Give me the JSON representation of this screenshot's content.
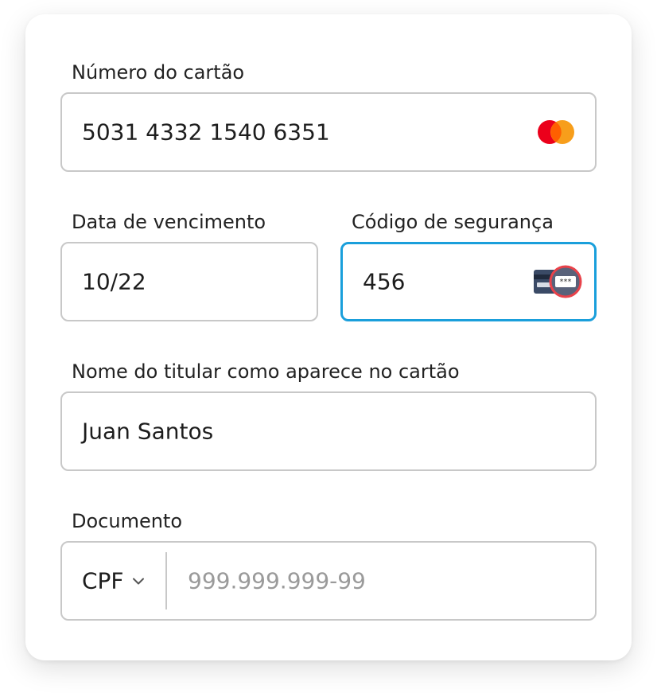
{
  "form": {
    "card_number": {
      "label": "Número do cartão",
      "value": "5031 4332 1540 6351",
      "brand_icon": "mastercard-icon"
    },
    "expiry": {
      "label": "Data de vencimento",
      "value": "10/22"
    },
    "security_code": {
      "label": "Código de segurança",
      "value": "456",
      "icon": "card-cvv-icon",
      "icon_text": "***",
      "focused": true
    },
    "holder_name": {
      "label": "Nome do titular como aparece no cartão",
      "value": "Juan Santos"
    },
    "document": {
      "label": "Documento",
      "type_selected": "CPF",
      "placeholder": "999.999.999-99"
    }
  },
  "colors": {
    "focus_border": "#1a9fdb",
    "field_border": "#c8c8c8",
    "mastercard_red": "#eb001b",
    "mastercard_orange": "#f79e1b",
    "cvv_highlight": "#e8424a"
  }
}
